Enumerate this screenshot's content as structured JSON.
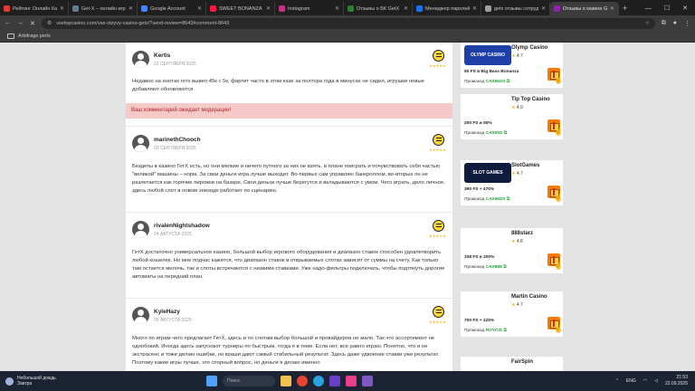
{
  "browser": {
    "tabs": [
      {
        "title": "Рейтинг Онлайн Каз",
        "color": "#e53935",
        "active": false
      },
      {
        "title": "Get-X – онлайн игр",
        "color": "#607d8b",
        "active": false
      },
      {
        "title": "Google Account",
        "color": "#4285f4",
        "active": false
      },
      {
        "title": "SWEET BONANZA 10",
        "color": "#ff1744",
        "active": false
      },
      {
        "title": "Instagram",
        "color": "#c13584",
        "active": false
      },
      {
        "title": "Отзывы о БК GetX б",
        "color": "#2e7d32",
        "active": false
      },
      {
        "title": "Менеджер паролей",
        "color": "#1a73e8",
        "active": false
      },
      {
        "title": "getx отзывы сотруд",
        "color": "#9e9e9e",
        "active": false
      },
      {
        "title": "Отзывы о казино Ge",
        "color": "#8e24aa",
        "active": true
      }
    ],
    "url": "vsetopcasino.com/vse-otzyvy-casino-getx/?send-review=8643#comment-8643",
    "bookmarks_folder": "Arbitrage perls",
    "bookmarks_right": "Все закладки"
  },
  "comments": [
    {
      "name": "Kertis",
      "date": "22 СЕНТЯБРЯ 2025",
      "text": "Недавно на енотах гетх вывел 45к с 5к, фартит часто в этом казе за полтора года в минусах не сидел, игрушки новые добавляют обновляются",
      "stars": "★★★★★"
    },
    {
      "name": "marinethChooch",
      "date": "03 СЕНТЯБРЯ 2025",
      "text": "Бездеты в казино ГетХ есть, но они мелкие и ничего путного за них не взять, в плане поиграть и почувствовать себя частью \"великой\" машины – норм. За свои деньги игра лучше выходит. Во-первых сам управляю банкроллом, во-вторых он не разлетается как горячие пирожки на базаре. Свои деньги лучше берегутся и вкладываются с умом. Чего играть, дело личное, здесь любой слот в новом эпизоде работает по сценарию.",
      "stars": "★★★★★"
    },
    {
      "name": "rivalenNightshadow",
      "date": "24 АВГУСТА 2025",
      "text": "ГетХ достаточно универсальное казино, большой выбор игрового оборудования и диапазон ставок способен удовлетворить любой кошелек. Но мне подчас кажется, что диапазон ставок в открываемых слотах зависит от суммы на счету. Как только там остается мелочь, так и слоты встречаются с низкими ставками. Уже надо-фильтры подключать, чтобы подтянуть дорогие автоматы на передний план.",
      "stars": "★★★★★"
    },
    {
      "name": "KyleHazy",
      "date": "05 АВГУСТА 2025",
      "text": "Много по играм чего предлагает ГетХ, здесь и по слотам выбор большой и провайдеров не мало. Так что ассортимент не однобокий. Иногда здесь запускают турниры по быстрым, тогда я в теме. Если нет, все равно играю. Понятно, что и не экстрасенс и тоже делаю ошибки, но краши дают самый стабильный результат. Здесь даже удвоение ставки уже результат. Поэтому какие игры лучше, это спорный вопрос, но деньги я делаю именно",
      "stars": "★★★★★"
    }
  ],
  "moderation_notice": "Ваш комментарий ожидает модерации!",
  "casinos": [
    {
      "name": "Olymp Casino",
      "rating": "4.7",
      "bonus": "50 FS в Big Bass Bonanza",
      "promo_label": "Промокод",
      "promo_code": "CASINOS",
      "logo_color": "#1e3fa8",
      "logo_text": "OLYMP CASINO"
    },
    {
      "name": "Tip Top Casino",
      "rating": "4.9",
      "bonus": "200 FS и 50%",
      "promo_label": "Промокод",
      "promo_code": "CASINO",
      "logo_color": "#ffffff",
      "logo_text": ""
    },
    {
      "name": "SlotGames",
      "rating": "4.7",
      "bonus": "390 FS + 470%",
      "promo_label": "Промокод",
      "promo_code": "CASINOS",
      "logo_color": "#0d1b3d",
      "logo_text": "SLOT GAMES"
    },
    {
      "name": "888starz",
      "rating": "4.8",
      "bonus": "338 FS и 200%",
      "promo_label": "Промокод",
      "promo_code": "CAS888",
      "logo_color": "#ffffff",
      "logo_text": ""
    },
    {
      "name": "Martin Casino",
      "rating": "4.7",
      "bonus": "700 FS + 225%",
      "promo_label": "Промокод",
      "promo_code": "ROYCIS",
      "logo_color": "#ffffff",
      "logo_text": ""
    },
    {
      "name": "FairSpin",
      "rating": "",
      "bonus": "",
      "promo_label": "",
      "promo_code": "",
      "logo_color": "#ffffff",
      "logo_text": ""
    }
  ],
  "taskbar": {
    "weather_title": "Небольшой дождь",
    "weather_sub": "Завтра",
    "search_placeholder": "Поиск",
    "lang": "ENG",
    "time": "21:53",
    "date": "22.09.2025"
  }
}
